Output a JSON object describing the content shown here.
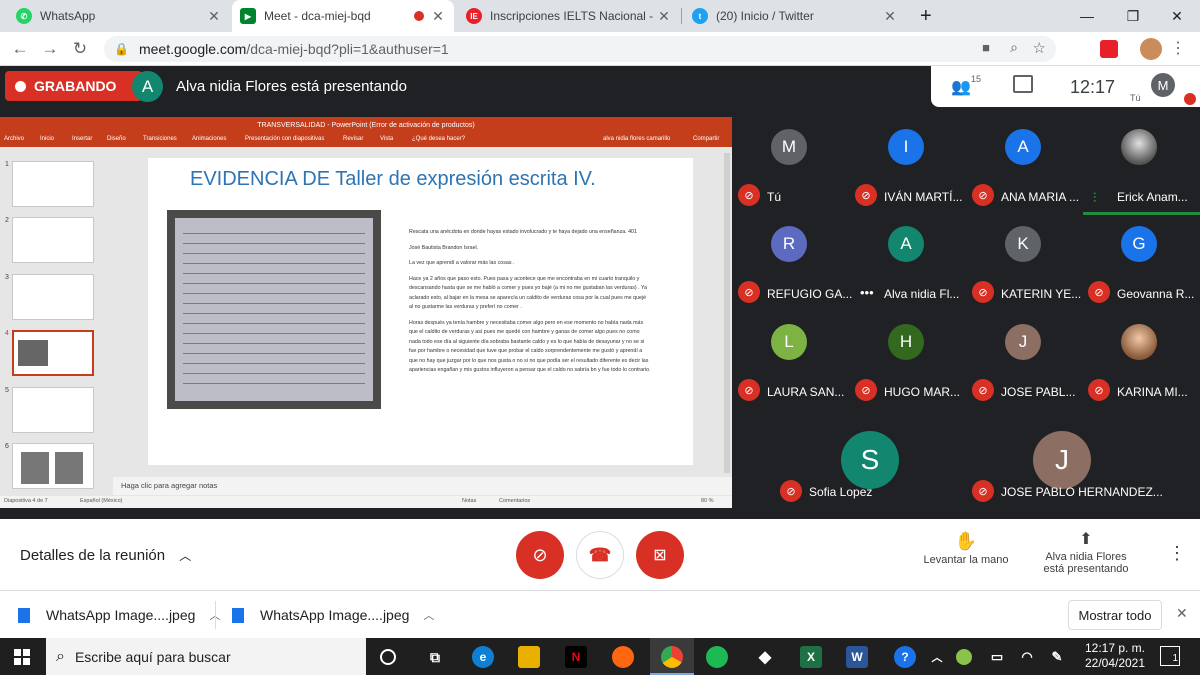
{
  "browser": {
    "tabs": [
      {
        "title": "WhatsApp",
        "favicon": "whatsapp-icon",
        "color": "#25d366"
      },
      {
        "title": "Meet - dca-miej-bqd",
        "favicon": "meet-icon",
        "color": "#00832d"
      },
      {
        "title": "Inscripciones IELTS Nacional - IEL",
        "favicon": "ielts-icon",
        "color": "#e8202a"
      },
      {
        "title": "(20) Inicio / Twitter",
        "favicon": "twitter-icon",
        "color": "#1da1f2"
      }
    ],
    "new_tab": "+",
    "url_domain": "meet.google.com",
    "url_path": "/dca-miej-bqd?pli=1&authuser=1"
  },
  "meet": {
    "recording_label": "GRABANDO",
    "presenter_initial": "A",
    "presenter_text": "Alva nidia Flores está presentando",
    "participant_count": "15",
    "time": "12:17",
    "self_label": "Tú",
    "self_initial": "M"
  },
  "ppt": {
    "window_title": "TRANSVERSALIDAD - PowerPoint (Error de activación de productos)",
    "ribbon": [
      "Archivo",
      "Inicio",
      "Insertar",
      "Diseño",
      "Transiciones",
      "Animaciones",
      "Presentación con diapositivas",
      "Revisar",
      "Vista",
      "¿Qué desea hacer?"
    ],
    "user": "alva nidia flores camarillo",
    "share": "Compartir",
    "thumb_numbers": [
      "1",
      "2",
      "3",
      "4",
      "5",
      "6"
    ],
    "slide_title": "EVIDENCIA DE Taller de expresión escrita IV.",
    "slide_text": [
      "Rescata una anécdota en donde hayas estado involucrado y te haya dejado una enseñanza. 401",
      "José Bautista Brandon Israel.",
      "La vez que aprendí a valorar más las cosas .",
      "Hace ya 2 años que paso esto. Pues pasa y acontece que me encontraba en mi cuarto tranquilo y descansando hasta que se me habló a comer y pues yo bajé (a mi no me gustaban las verduras) . Ya aclarado esto, al bajar en la mesa se aparecía un caldito de verduras cosa por la cual pues me quejé al no gustarme las verduras y preferí no comer .",
      "Horas después ya tenía hambre y necesitaba comer algo pero en ese momento no había nada más que el caldito de verduras y así pues me quedé con hambre y ganas de comer algo pues no como nada todo ese día al siguiente día sobraba bastante caldo y es lo que había de desayunar y no se si fue por hambre o necesidad que tuve que probar el caldo sorprendentemente me gustó y aprendí a que no hay que juzgar por lo que nos gusta o no si no que podía ser el resultado diferente es decir las apariencias engañan y mis gustos influyeron a pensar que el caldo no sabría bn y fue todo lo contrario."
    ],
    "notes_placeholder": "Haga clic para agregar notas",
    "status_slide": "Diapositiva 4 de 7",
    "status_lang": "Español (México)",
    "status_notes": "Notas",
    "status_comments": "Comentarios",
    "zoom": "80 %"
  },
  "participants": [
    {
      "name": "Tú",
      "initial": "M",
      "color": "#5f6368",
      "muted": true
    },
    {
      "name": "IVÁN MARTÍ...",
      "initial": "I",
      "color": "#1a73e8",
      "muted": true
    },
    {
      "name": "ANA MARIA ...",
      "initial": "A",
      "color": "#1a73e8",
      "muted": true
    },
    {
      "name": "Erick Anam...",
      "initial": "",
      "color": "#9e9e9e",
      "muted": false,
      "speaking": true
    },
    {
      "name": "REFUGIO GA...",
      "initial": "R",
      "color": "#5c6bc0",
      "muted": true
    },
    {
      "name": "Alva nidia Fl...",
      "initial": "A",
      "color": "#12866f",
      "muted": false
    },
    {
      "name": "KATERIN YE...",
      "initial": "K",
      "color": "#5f6368",
      "muted": true
    },
    {
      "name": "Geovanna R...",
      "initial": "G",
      "color": "#1a73e8",
      "muted": true
    },
    {
      "name": "LAURA SAN...",
      "initial": "L",
      "color": "#7cb342",
      "muted": true
    },
    {
      "name": "HUGO MAR...",
      "initial": "H",
      "color": "#33691e",
      "muted": true
    },
    {
      "name": "JOSE PABL...",
      "initial": "J",
      "color": "#8d6e63",
      "muted": true
    },
    {
      "name": "KARINA MI...",
      "initial": "",
      "color": "#c9a27a",
      "muted": true
    },
    {
      "name": "Sofia Lopez",
      "initial": "S",
      "color": "#12866f",
      "muted": true
    },
    {
      "name": "JOSE PABLO HERNANDEZ...",
      "initial": "J",
      "color": "#8d6e63",
      "muted": true
    }
  ],
  "bottom": {
    "details": "Detalles de la reunión",
    "raise_hand": "Levantar la mano",
    "presenting_line1": "Alva nidia Flores",
    "presenting_line2": "está presentando"
  },
  "downloads": {
    "items": [
      "WhatsApp Image....jpeg",
      "WhatsApp Image....jpeg"
    ],
    "show_all": "Mostrar todo"
  },
  "taskbar": {
    "search_placeholder": "Escribe aquí para buscar",
    "time": "12:17 p. m.",
    "date": "22/04/2021",
    "notif_count": "1"
  }
}
